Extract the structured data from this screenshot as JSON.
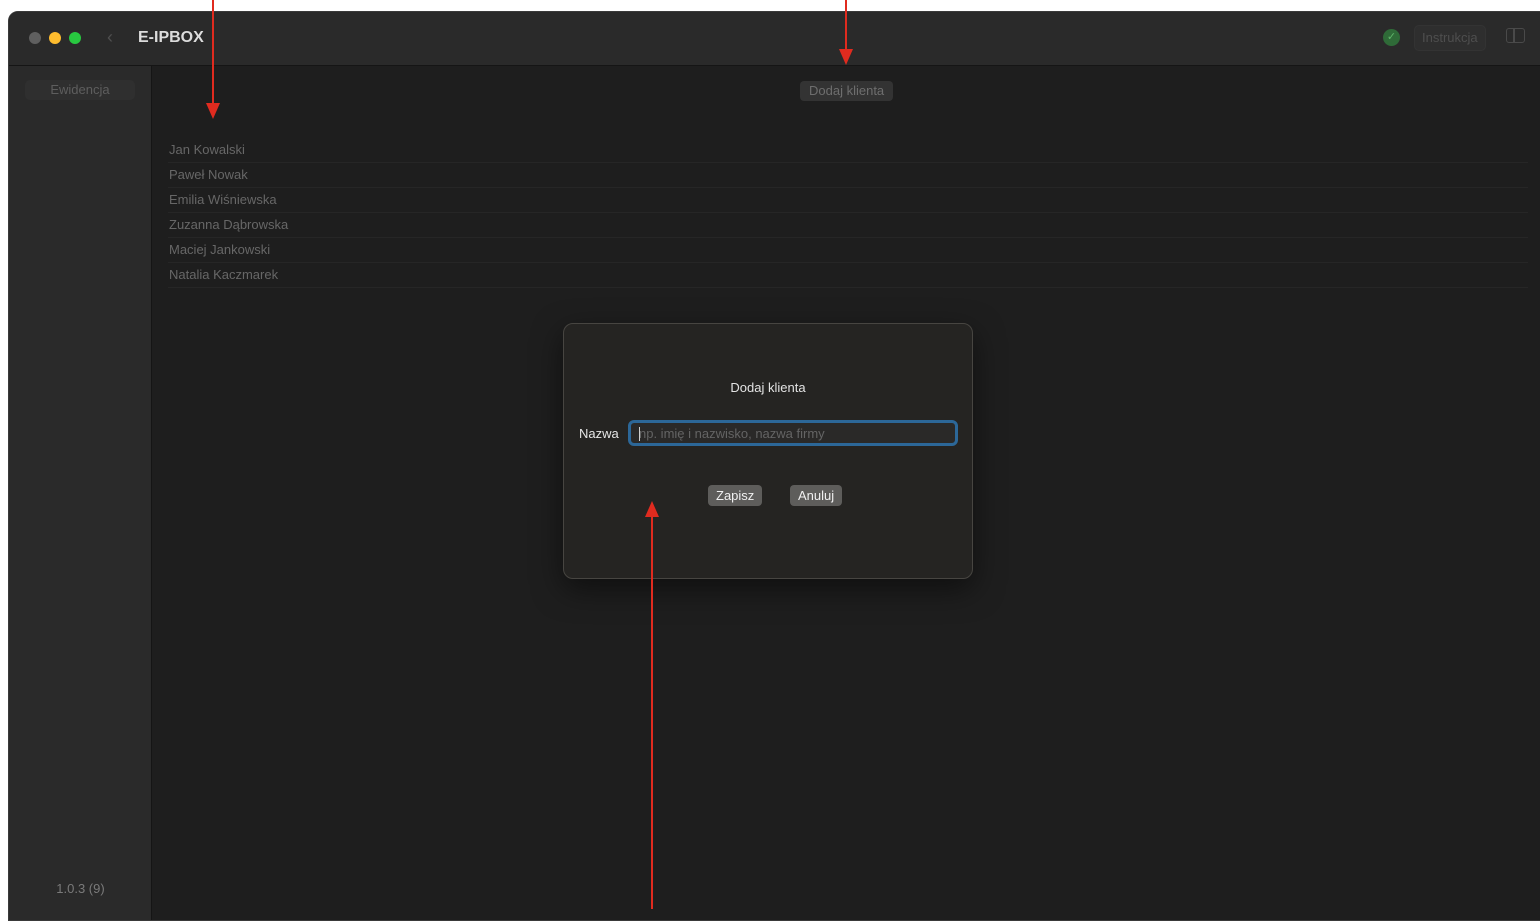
{
  "window": {
    "title": "E-IPBOX",
    "back_icon": "chevron-left-icon",
    "status_icon": "check-circle-icon",
    "help_label": "Instrukcja",
    "sidebar_toggle_icon": "sidebar-toggle-icon"
  },
  "sidebar": {
    "items": [
      {
        "label": "Ewidencja"
      }
    ],
    "version": "1.0.3 (9)"
  },
  "main": {
    "add_client_label": "Dodaj klienta",
    "clients": [
      "Jan Kowalski",
      "Paweł Nowak",
      "Emilia Wiśniewska",
      "Zuzanna Dąbrowska",
      "Maciej Jankowski",
      "Natalia Kaczmarek"
    ]
  },
  "dialog": {
    "title": "Dodaj klienta",
    "name_label": "Nazwa",
    "name_value": "",
    "name_placeholder": "np. imię i nazwisko, nazwa firmy",
    "save_label": "Zapisz",
    "cancel_label": "Anuluj"
  },
  "annotations": {
    "arrow_color": "#e02b1f"
  },
  "colors": {
    "accent_focus": "#2c6798",
    "traffic_min": "#febc2e",
    "traffic_max": "#28c840",
    "status_ok": "#2f6b38"
  }
}
